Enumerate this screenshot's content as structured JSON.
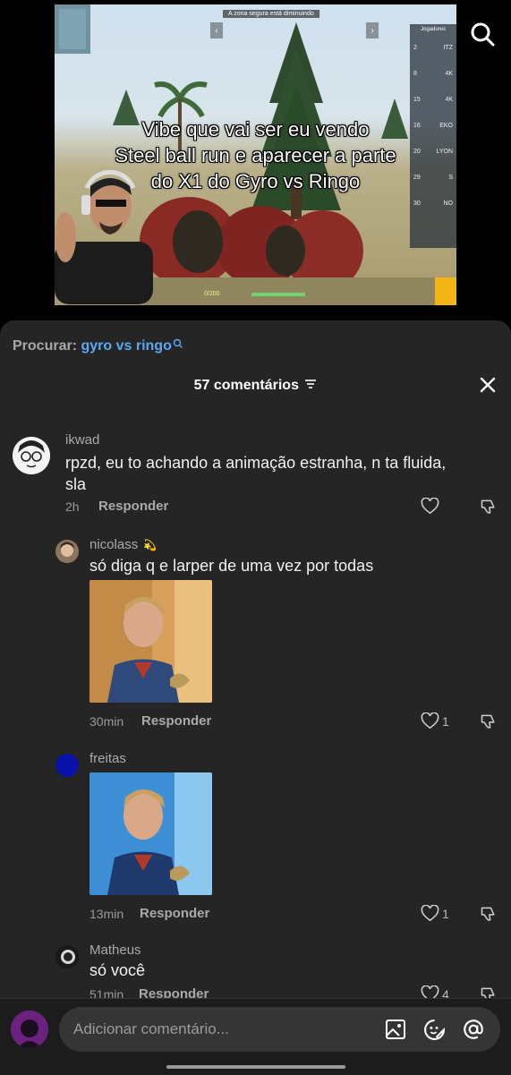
{
  "video": {
    "caption_lines": [
      "Vibe que vai ser eu vendo",
      "Steel ball run e aparecer a parte",
      "do X1 do Gyro vs Ringo"
    ],
    "hud_top_text": "A zona segura está diminuindo",
    "hud_player_text": "0/200",
    "scoreboard": {
      "title": "Jogadores",
      "rows": [
        {
          "rank": "2",
          "name": "ITZ"
        },
        {
          "rank": "8",
          "name": "4K"
        },
        {
          "rank": "15",
          "name": "4K"
        },
        {
          "rank": "16",
          "name": "EKO"
        },
        {
          "rank": "20",
          "name": "LYON"
        },
        {
          "rank": "29",
          "name": "S"
        },
        {
          "rank": "30",
          "name": "NO"
        }
      ]
    }
  },
  "search": {
    "label": "Procurar:",
    "query": "gyro vs ringo"
  },
  "comments_header": {
    "title": "57 comentários"
  },
  "comments": [
    {
      "username": "ikwad",
      "text_line1": "rpzd, eu to achando a animação estranha, n ta fluida,",
      "text_line2": "sla",
      "time": "2h",
      "reply_label": "Responder"
    },
    {
      "username": "nicolass",
      "username_badge": "💫",
      "text": "só diga q e larper de uma vez por todas",
      "time": "30min",
      "reply_label": "Responder",
      "likes": "1"
    },
    {
      "username": "freitas",
      "time": "13min",
      "reply_label": "Responder",
      "likes": "1"
    },
    {
      "username": "Matheus",
      "text": "só você",
      "time": "51min",
      "reply_label": "Responder",
      "likes": "4"
    }
  ],
  "composer": {
    "placeholder": "Adicionar comentário..."
  },
  "icons": {
    "search": "search-icon",
    "close": "close-icon",
    "filter": "filter-icon",
    "heart": "heart-icon",
    "dislike": "thumbs-down-icon",
    "image": "image-icon",
    "emoji": "emoji-icon",
    "mention": "at-icon"
  },
  "colors": {
    "accent_link": "#5aa9f0",
    "panel_bg": "#252525"
  }
}
